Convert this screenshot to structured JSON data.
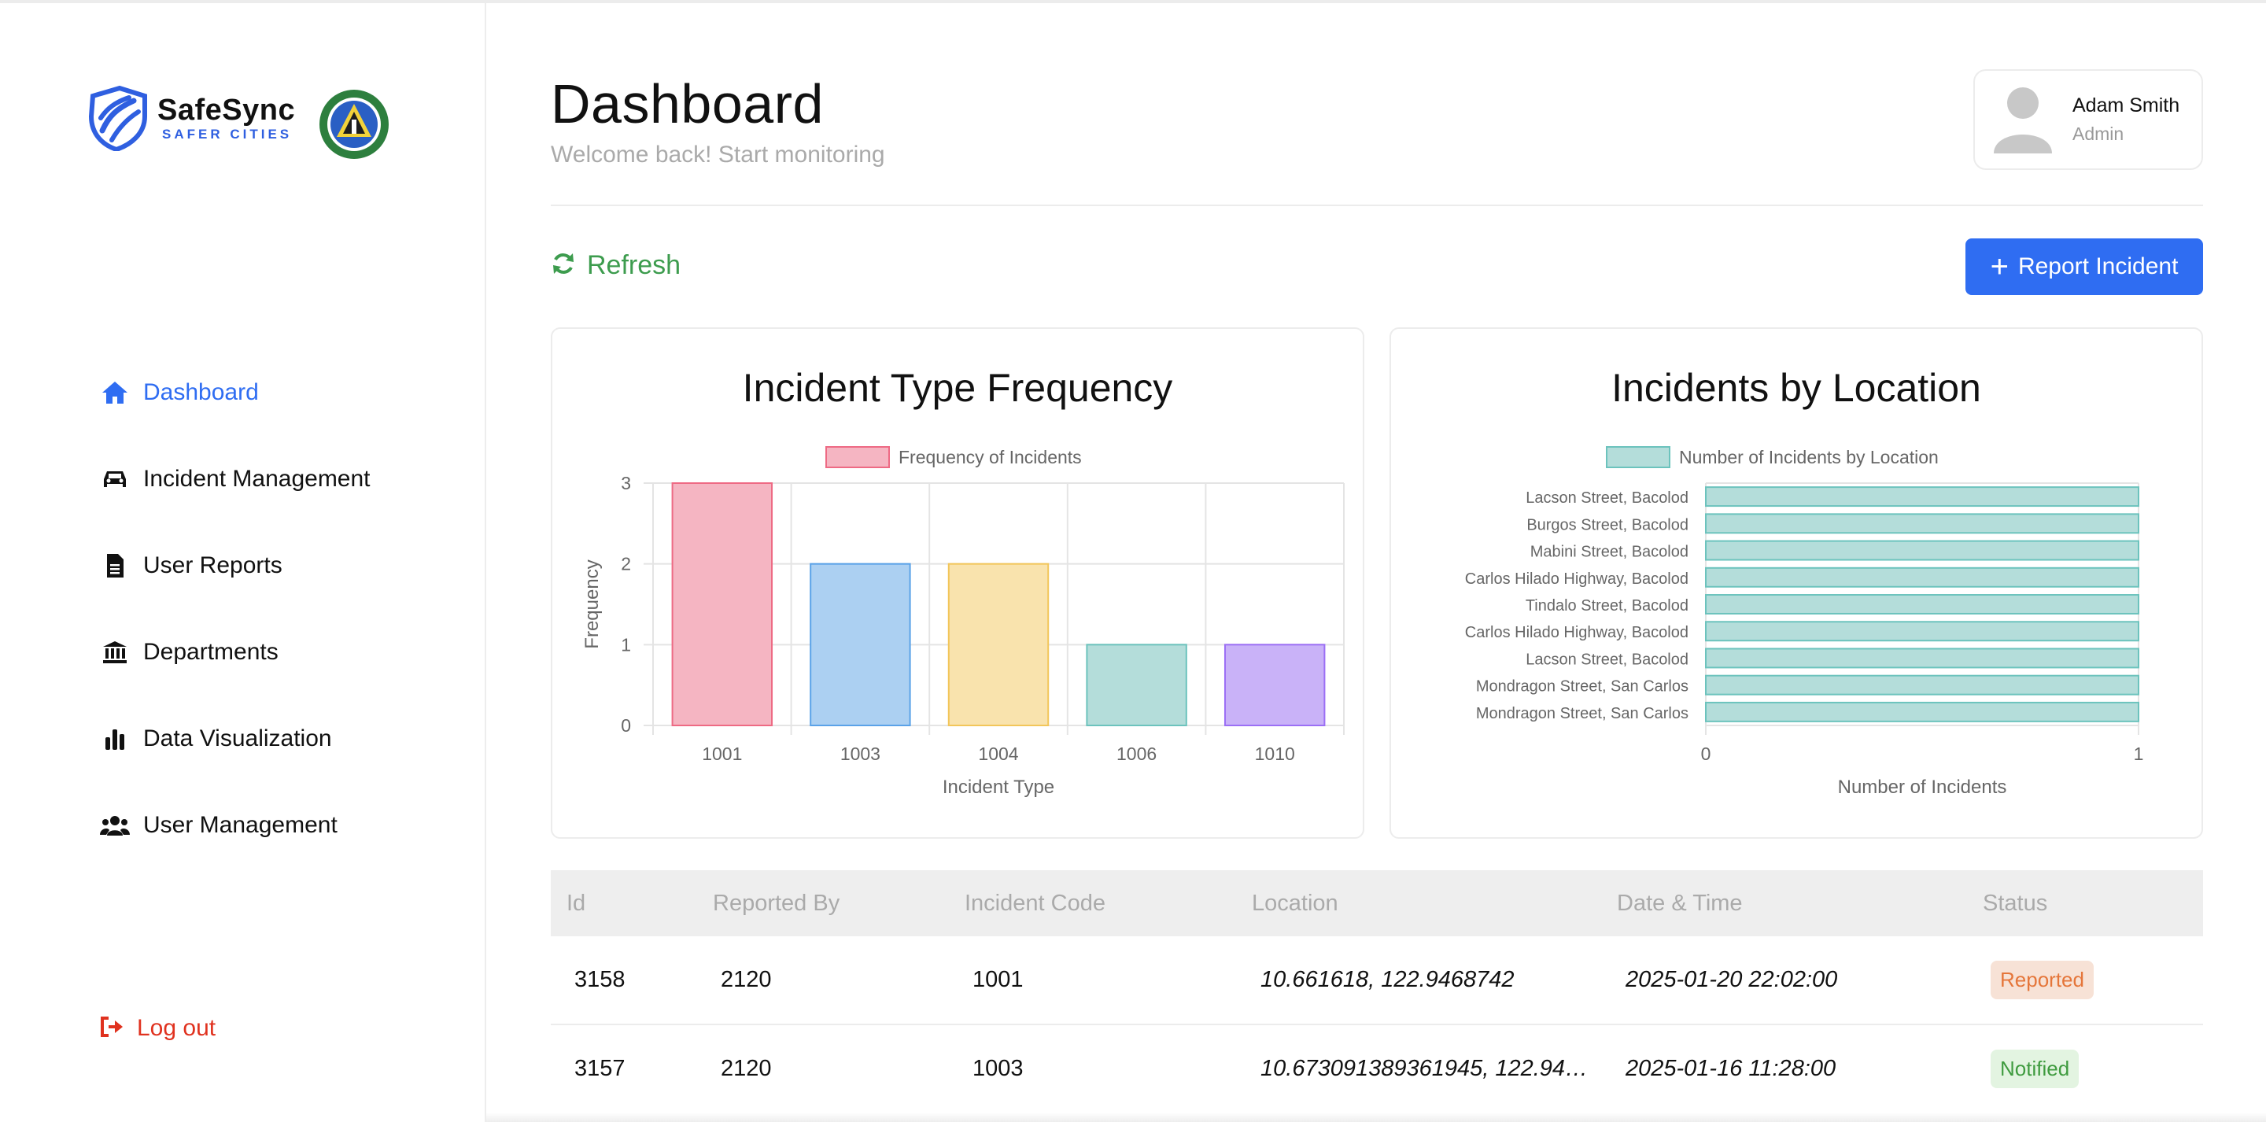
{
  "brand": {
    "name": "SafeSync",
    "tagline": "SAFER CITIES"
  },
  "sidebar": {
    "items": [
      {
        "label": "Dashboard",
        "icon": "home-icon",
        "active": true
      },
      {
        "label": "Incident Management",
        "icon": "car-icon"
      },
      {
        "label": "User Reports",
        "icon": "file-icon"
      },
      {
        "label": "Departments",
        "icon": "bank-icon"
      },
      {
        "label": "Data Visualization",
        "icon": "bar-chart-icon"
      },
      {
        "label": "User Management",
        "icon": "users-icon"
      }
    ],
    "logout_label": "Log out"
  },
  "header": {
    "title": "Dashboard",
    "subtitle": "Welcome back! Start monitoring"
  },
  "user": {
    "name": "Adam Smith",
    "role": "Admin"
  },
  "toolbar": {
    "refresh_label": "Refresh",
    "report_label": "Report Incident"
  },
  "colors": {
    "accent": "#2f6df2",
    "refresh": "#3d9c4e",
    "logout": "#e0321f"
  },
  "chart_data": [
    {
      "type": "bar",
      "title": "Incident Type Frequency",
      "categories": [
        "1001",
        "1003",
        "1004",
        "1006",
        "1010"
      ],
      "series": [
        {
          "name": "Frequency of Incidents",
          "values": [
            3,
            2,
            2,
            1,
            1
          ]
        }
      ],
      "bar_colors": [
        "#f5b5c2",
        "#acd0f2",
        "#f9e3ad",
        "#b4ddda",
        "#c9b2f8"
      ],
      "bar_borders": [
        "#ee6a84",
        "#5aa2e8",
        "#f2c65a",
        "#6cc3bd",
        "#9b6ff5"
      ],
      "xlabel": "Incident Type",
      "ylabel": "Frequency",
      "ylim": [
        0,
        3
      ],
      "yticks": [
        0,
        1,
        2,
        3
      ],
      "grid": true,
      "legend": "top"
    },
    {
      "type": "bar",
      "orientation": "horizontal",
      "title": "Incidents by Location",
      "categories": [
        "Lacson Street, Bacolod",
        "Burgos Street, Bacolod",
        "Mabini Street, Bacolod",
        "Carlos Hilado Highway, Bacolod",
        "Tindalo Street, Bacolod",
        "Carlos Hilado Highway, Bacolod",
        "Lacson Street, Bacolod",
        "Mondragon Street, San Carlos",
        "Mondragon Street, San Carlos"
      ],
      "series": [
        {
          "name": "Number of Incidents by Location",
          "values": [
            1,
            1,
            1,
            1,
            1,
            1,
            1,
            1,
            1
          ]
        }
      ],
      "bar_color": "#b4ddda",
      "bar_border": "#6cc3bd",
      "xlabel": "Number of Incidents",
      "ylabel": "",
      "xlim": [
        0,
        1
      ],
      "xticks": [
        0,
        1
      ],
      "grid": true,
      "legend": "top"
    }
  ],
  "table": {
    "columns": [
      "Id",
      "Reported By",
      "Incident Code",
      "Location",
      "Date & Time",
      "Status"
    ],
    "rows": [
      {
        "id": "3158",
        "reported_by": "2120",
        "code": "1001",
        "location": "10.661618, 122.9468742",
        "datetime": "2025-01-20 22:02:00",
        "status": "Reported"
      },
      {
        "id": "3157",
        "reported_by": "2120",
        "code": "1003",
        "location": "10.673091389361945, 122.947...",
        "datetime": "2025-01-16 11:28:00",
        "status": "Notified"
      }
    ],
    "status_colors": {
      "Reported": {
        "bg": "#f7e2d6",
        "fg": "#e5763a"
      },
      "Notified": {
        "bg": "#e3f4e1",
        "fg": "#3f9b3f"
      }
    }
  }
}
